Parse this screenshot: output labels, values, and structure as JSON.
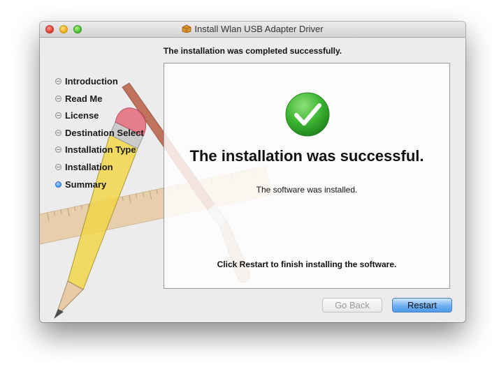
{
  "window": {
    "title": "Install Wlan USB Adapter Driver"
  },
  "header": {
    "status": "The installation was completed successfully."
  },
  "sidebar": {
    "steps": [
      {
        "label": "Introduction",
        "active": false
      },
      {
        "label": "Read Me",
        "active": false
      },
      {
        "label": "License",
        "active": false
      },
      {
        "label": "Destination Select",
        "active": false
      },
      {
        "label": "Installation Type",
        "active": false
      },
      {
        "label": "Installation",
        "active": false
      },
      {
        "label": "Summary",
        "active": true
      }
    ]
  },
  "content": {
    "icon": "checkmark-icon",
    "title": "The installation was successful.",
    "subtitle": "The software was installed.",
    "instruction": "Click Restart to finish installing the software."
  },
  "buttons": {
    "back_label": "Go Back",
    "back_enabled": false,
    "restart_label": "Restart"
  },
  "colors": {
    "success_green": "#3cb532",
    "default_button_blue": "#5aa3ee",
    "active_step_blue": "#2f7fe0"
  }
}
